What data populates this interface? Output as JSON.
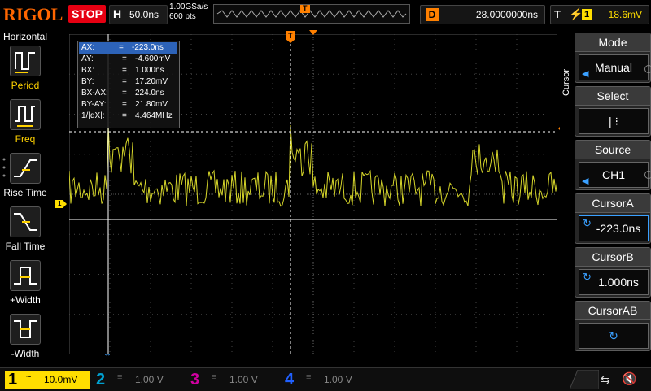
{
  "header": {
    "brand": "RIGOL",
    "run_state": "STOP",
    "run_state_color": "#e60012",
    "horizontal_label": "H",
    "timebase": "50.0ns",
    "sample_rate": "1.00GSa/s",
    "memory_depth": "600 pts",
    "trigger_marker": "T",
    "delay_label": "D",
    "delay_value": "28.0000000ns",
    "trigger_label": "T",
    "trigger_edge": "rising-edge-icon",
    "trigger_source": "1",
    "trigger_level": "18.6mV"
  },
  "left_panel": {
    "title": "Horizontal",
    "items": [
      {
        "label": "Period",
        "icon": "period-icon"
      },
      {
        "label": "Freq",
        "icon": "freq-icon"
      },
      {
        "label": "Rise Time",
        "icon": "rise-time-icon"
      },
      {
        "label": "Fall Time",
        "icon": "fall-time-icon"
      },
      {
        "label": "+Width",
        "icon": "positive-width-icon"
      },
      {
        "label": "-Width",
        "icon": "negative-width-icon"
      }
    ]
  },
  "cursor_readout": {
    "rows": [
      {
        "label": "AX:",
        "value": "-223.0ns"
      },
      {
        "label": "AY:",
        "value": "-4.600mV"
      },
      {
        "label": "BX:",
        "value": "1.000ns"
      },
      {
        "label": "BY:",
        "value": "17.20mV"
      },
      {
        "label": "BX-AX:",
        "value": "224.0ns"
      },
      {
        "label": "BY-AY:",
        "value": "21.80mV"
      },
      {
        "label": "1/|dX|:",
        "value": "4.464MHz"
      }
    ],
    "equals": "="
  },
  "waveform": {
    "channel_marker": "1",
    "trace_color": "#d6d62a",
    "trigger_level_marker": "T"
  },
  "right_panel": {
    "side_title": "Cursor",
    "mode": {
      "title": "Mode",
      "value": "Manual"
    },
    "select": {
      "title": "Select",
      "value": "|   ⁝"
    },
    "source": {
      "title": "Source",
      "value": "CH1"
    },
    "cursor_a": {
      "title": "CursorA",
      "value": "-223.0ns"
    },
    "cursor_b": {
      "title": "CursorB",
      "value": "1.000ns"
    },
    "cursor_ab": {
      "title": "CursorAB",
      "value": "↻"
    }
  },
  "bottom": {
    "channels": [
      {
        "num": "1",
        "coupling": "~",
        "scale": "10.0mV",
        "color": "#ffde00"
      },
      {
        "num": "2",
        "coupling": "≡",
        "scale": "1.00 V",
        "color": "#00a0d0"
      },
      {
        "num": "3",
        "coupling": "≡",
        "scale": "1.00 V",
        "color": "#d000a0"
      },
      {
        "num": "4",
        "coupling": "≡",
        "scale": "1.00 V",
        "color": "#2060ff"
      }
    ],
    "usb_icon": "usb-icon",
    "sound_icon": "speaker-muted-icon"
  }
}
